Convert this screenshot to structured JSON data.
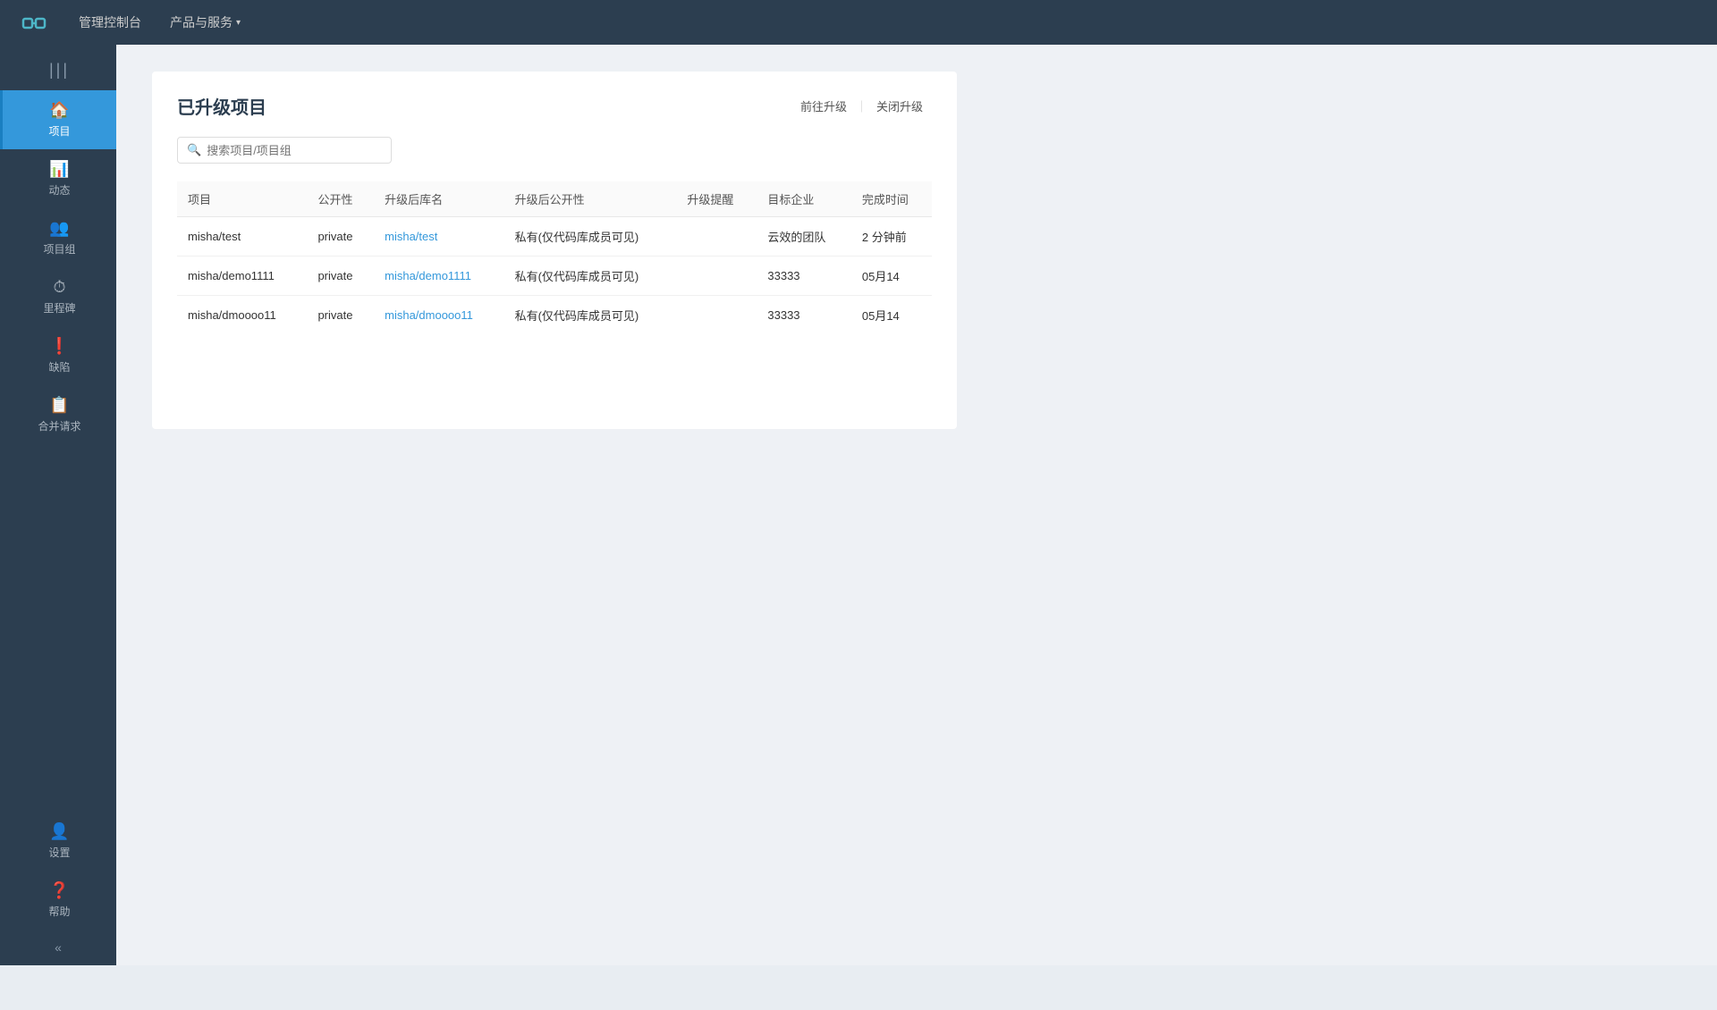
{
  "topnav": {
    "logo_alt": "Logo",
    "items": [
      {
        "label": "管理控制台",
        "has_arrow": false
      },
      {
        "label": "产品与服务",
        "has_arrow": true
      }
    ]
  },
  "sidebar": {
    "collapse_icon": "|||",
    "items": [
      {
        "id": "projects",
        "label": "项目",
        "icon": "🏠",
        "active": true
      },
      {
        "id": "activity",
        "label": "动态",
        "icon": "📊",
        "active": false
      },
      {
        "id": "groups",
        "label": "项目组",
        "icon": "👥",
        "active": false
      },
      {
        "id": "milestones",
        "label": "里程碑",
        "icon": "⏱",
        "active": false
      },
      {
        "id": "issues",
        "label": "缺陷",
        "icon": "❗",
        "active": false
      },
      {
        "id": "merge",
        "label": "合并请求",
        "icon": "📋",
        "active": false
      },
      {
        "id": "settings",
        "label": "设置",
        "icon": "👤",
        "active": false
      },
      {
        "id": "help",
        "label": "帮助",
        "icon": "❓",
        "active": false
      }
    ],
    "collapse_bottom_icon": "«"
  },
  "page": {
    "title": "已升级项目",
    "actions": [
      {
        "label": "前往升级",
        "type": "link"
      },
      {
        "label": "关闭升级",
        "type": "link"
      }
    ],
    "search": {
      "placeholder": "搜索项目/项目组"
    },
    "table": {
      "columns": [
        "项目",
        "公开性",
        "升级后库名",
        "升级后公开性",
        "升级提醒",
        "目标企业",
        "完成时间"
      ],
      "rows": [
        {
          "project": "misha/test",
          "visibility": "private",
          "upgraded_repo": "misha/test",
          "upgraded_visibility": "私有(仅代码库成员可见)",
          "upgrade_reminder": "",
          "target_org": "云效的团队",
          "completed_at": "2 分钟前"
        },
        {
          "project": "misha/demo1111",
          "visibility": "private",
          "upgraded_repo": "misha/demo1111",
          "upgraded_visibility": "私有(仅代码库成员可见)",
          "upgrade_reminder": "",
          "target_org": "33333",
          "completed_at": "05月14"
        },
        {
          "project": "misha/dmoooo11",
          "visibility": "private",
          "upgraded_repo": "misha/dmoooo11",
          "upgraded_visibility": "私有(仅代码库成员可见)",
          "upgrade_reminder": "",
          "target_org": "33333",
          "completed_at": "05月14"
        }
      ]
    }
  }
}
